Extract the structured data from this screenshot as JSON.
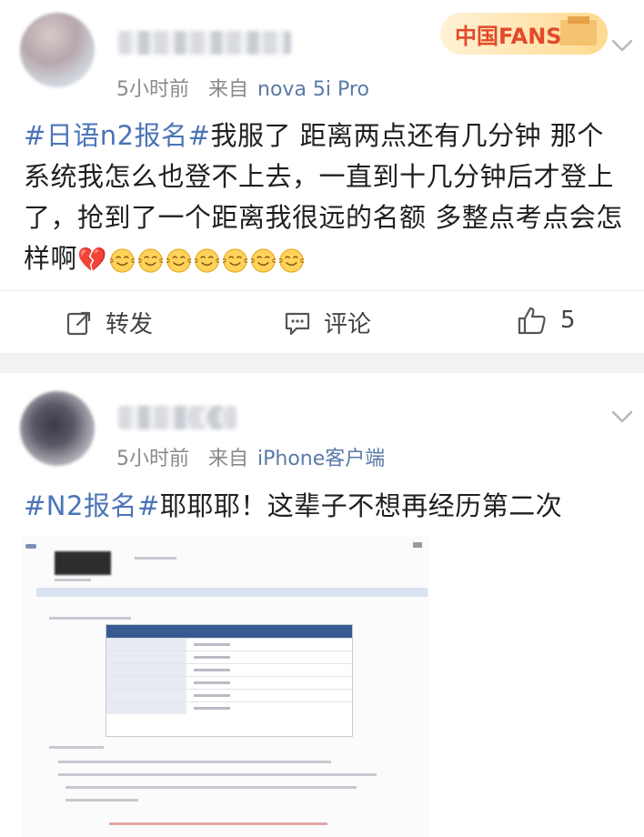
{
  "posts": [
    {
      "time": "5小时前",
      "source_prefix": "来自",
      "source": "nova 5i Pro",
      "badge_text": "中国FANS",
      "tag": "#日语n2报名#",
      "text": "我服了 距离两点还有几分钟 那个系统我怎么也登不上去，一直到十几分钟后才登上了，抢到了一个距离我很远的名额 多整点考点会怎样啊",
      "emoji_broken_heart": "💔",
      "emoji_count": 7,
      "actions": {
        "repost": "转发",
        "comment": "评论",
        "like_count": "5"
      }
    },
    {
      "time": "5小时前",
      "source_prefix": "来自",
      "source": "iPhone客户端",
      "tag": "#N2报名#",
      "text": "耶耶耶！这辈子不想再经历第二次"
    }
  ],
  "icons": [
    "chevron-down-icon",
    "repost-icon",
    "comment-icon",
    "like-icon",
    "broken-heart-icon",
    "smile-emoji-icon"
  ],
  "colors": {
    "link": "#4b74b8",
    "source": "#5a7aa8",
    "meta": "#8a8a8a",
    "divider": "#f2f2f2"
  }
}
